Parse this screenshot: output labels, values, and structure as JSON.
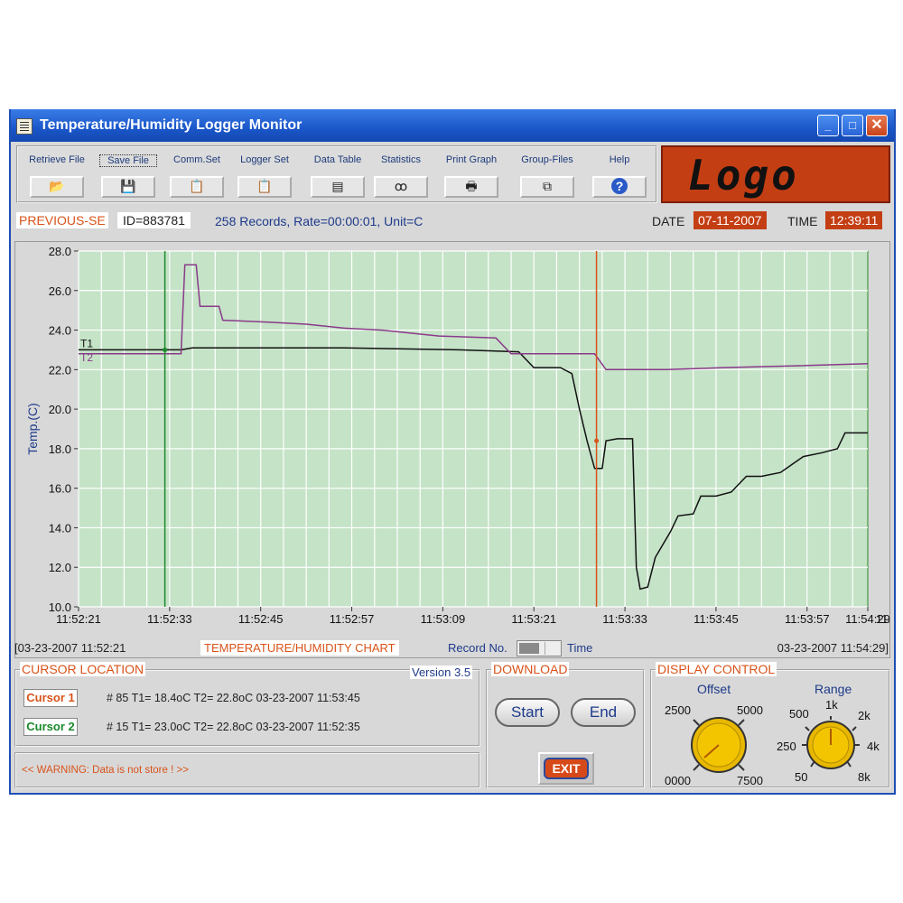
{
  "window": {
    "title": "Temperature/Humidity Logger Monitor"
  },
  "window_controls": {
    "minimize": "_",
    "maximize": "□",
    "close": "✕"
  },
  "toolbar": [
    {
      "label": "Retrieve File",
      "icon": "folder-open-icon",
      "glyph": "📂"
    },
    {
      "label": "Save File",
      "icon": "floppy-disk-icon",
      "glyph": "💾"
    },
    {
      "label": "Comm.Set",
      "icon": "clipboard-icon",
      "glyph": "📋"
    },
    {
      "label": "Logger Set",
      "icon": "clipboard-icon",
      "glyph": "📋"
    },
    {
      "label": "Data Table",
      "icon": "table-icon",
      "glyph": "▤"
    },
    {
      "label": "Statistics",
      "icon": "glasses-icon",
      "glyph": "ꝏ"
    },
    {
      "label": "Print Graph",
      "icon": "printer-icon",
      "glyph": "🖶"
    },
    {
      "label": "Group-Files",
      "icon": "files-icon",
      "glyph": "⧉"
    },
    {
      "label": "Help",
      "icon": "help-icon",
      "glyph": "?"
    }
  ],
  "logo": {
    "text": "Logo"
  },
  "info": {
    "previous": "PREVIOUS-SE",
    "id": "ID=883781",
    "records": "258 Records, Rate=00:00:01, Unit=C",
    "date_label": "DATE",
    "date": "07-11-2007",
    "time_label": "TIME",
    "time": "12:39:11"
  },
  "chart_data": {
    "type": "line",
    "ylabel": "Temp.(C)",
    "ylim": [
      10,
      28
    ],
    "yticks": [
      "10.0",
      "12.0",
      "14.0",
      "16.0",
      "18.0",
      "20.0",
      "22.0",
      "24.0",
      "26.0",
      "28.0"
    ],
    "xticks": [
      "11:52:21",
      "11:52:33",
      "11:52:45",
      "11:52:57",
      "11:53:09",
      "11:53:21",
      "11:53:33",
      "11:53:45",
      "11:53:57",
      "11:54:09",
      "11:54:29"
    ],
    "grid": true,
    "x_seconds_range": [
      0,
      128
    ],
    "series": [
      {
        "name": "T1",
        "color": "#111111",
        "points": [
          [
            0,
            23.0
          ],
          [
            27,
            23.0
          ],
          [
            30,
            23.1
          ],
          [
            70,
            23.1
          ],
          [
            100,
            23.0
          ],
          [
            116,
            22.9
          ],
          [
            120,
            22.1
          ],
          [
            127,
            22.1
          ],
          [
            130,
            21.8
          ],
          [
            132,
            20.0
          ],
          [
            134,
            18.4
          ],
          [
            136,
            17.0
          ],
          [
            138,
            17.0
          ],
          [
            139,
            18.4
          ],
          [
            142,
            18.5
          ],
          [
            146,
            18.5
          ],
          [
            147,
            12.0
          ],
          [
            148,
            10.9
          ],
          [
            150,
            11.0
          ],
          [
            152,
            12.5
          ],
          [
            156,
            13.8
          ],
          [
            158,
            14.6
          ],
          [
            162,
            14.7
          ],
          [
            164,
            15.6
          ],
          [
            168,
            15.6
          ],
          [
            172,
            15.8
          ],
          [
            176,
            16.6
          ],
          [
            180,
            16.6
          ],
          [
            185,
            16.8
          ],
          [
            188,
            17.2
          ],
          [
            191,
            17.6
          ],
          [
            196,
            17.8
          ],
          [
            200,
            18.0
          ],
          [
            202,
            18.8
          ],
          [
            208,
            18.8
          ]
        ]
      },
      {
        "name": "T2",
        "color": "#8a3a8a",
        "points": [
          [
            0,
            22.8
          ],
          [
            27,
            22.8
          ],
          [
            28,
            27.3
          ],
          [
            31,
            27.3
          ],
          [
            32,
            25.2
          ],
          [
            37,
            25.2
          ],
          [
            38,
            24.5
          ],
          [
            50,
            24.4
          ],
          [
            60,
            24.3
          ],
          [
            70,
            24.1
          ],
          [
            80,
            24.0
          ],
          [
            95,
            23.7
          ],
          [
            110,
            23.6
          ],
          [
            114,
            22.8
          ],
          [
            124,
            22.8
          ],
          [
            136,
            22.8
          ],
          [
            139,
            22.0
          ],
          [
            155,
            22.0
          ],
          [
            170,
            22.1
          ],
          [
            190,
            22.2
          ],
          [
            208,
            22.3
          ]
        ]
      }
    ],
    "x_seconds_max": 208,
    "cursor1": {
      "label": "Cursor 1",
      "x_seconds": 84,
      "color": "#d8531a",
      "marker_value": 18.4
    },
    "cursor2": {
      "label": "Cursor 2",
      "x_seconds": 14,
      "color": "#1a8a2a",
      "marker_value": 23.0
    }
  },
  "chart_footer": {
    "start": "[03-23-2007 11:52:21",
    "title": "TEMPERATURE/HUMIDITY CHART",
    "record_no": "Record No.",
    "time": "Time",
    "end": "03-23-2007 11:54:29]"
  },
  "cursor_location": {
    "title": "CURSOR LOCATION",
    "version": "Version 3.5",
    "cursor1_label": "Cursor 1",
    "cursor1_text": "#  85 T1= 18.4oC  T2= 22.8oC  03-23-2007 11:53:45",
    "cursor2_label": "Cursor 2",
    "cursor2_text": "#  15 T1= 23.0oC  T2= 22.8oC  03-23-2007 11:52:35",
    "warning": "<< WARNING: Data is not store ! >>"
  },
  "download": {
    "title": "DOWNLOAD",
    "start": "Start",
    "end": "End",
    "exit": "EXIT"
  },
  "display_control": {
    "title": "DISPLAY CONTROL",
    "offset_label": "Offset",
    "offset_scale": [
      "2500",
      "5000",
      "0000",
      "7500"
    ],
    "range_label": "Range",
    "range_scale": [
      "500",
      "1k",
      "2k",
      "250",
      "4k",
      "50",
      "8k"
    ]
  },
  "colors": {
    "accent": "#c43e14",
    "plot_bg": "#c5e3c7",
    "title_blue": "#1a56c9"
  }
}
